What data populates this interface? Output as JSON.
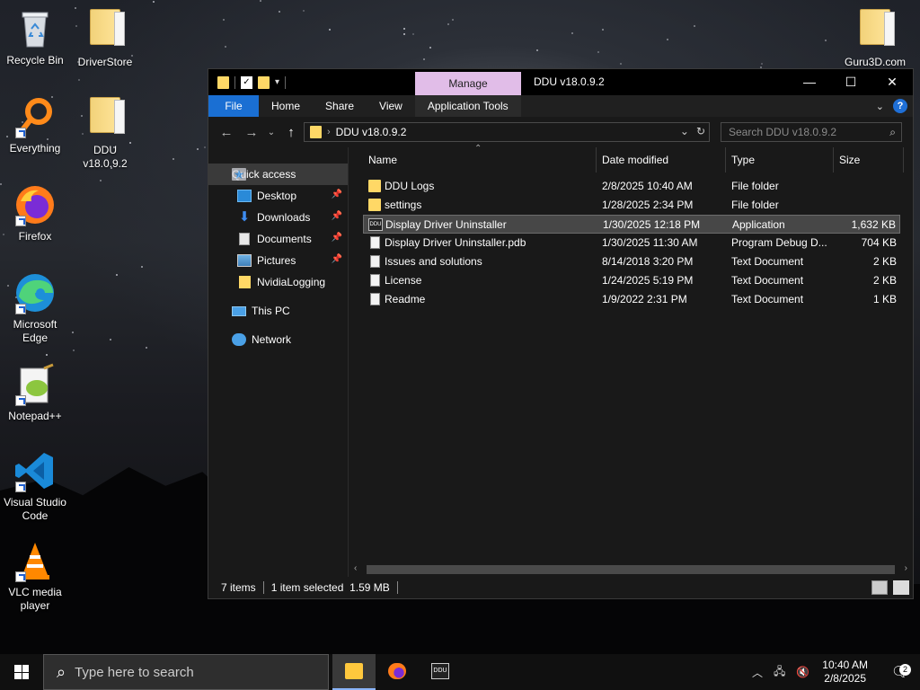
{
  "desktop": {
    "icons": [
      {
        "label": "Recycle Bin",
        "icon": "recycle-bin-icon"
      },
      {
        "label": "DriverStore",
        "icon": "folder-icon"
      },
      {
        "label": "Guru3D.com",
        "icon": "folder-icon"
      },
      {
        "label": "Everything",
        "icon": "everything-search-icon"
      },
      {
        "label": "DDU v18.0.9.2",
        "icon": "folder-zip-icon"
      },
      {
        "label": "Firefox",
        "icon": "firefox-icon"
      },
      {
        "label": "Microsoft Edge",
        "icon": "edge-icon"
      },
      {
        "label": "Notepad++",
        "icon": "notepadpp-icon"
      },
      {
        "label": "Visual Studio Code",
        "icon": "vscode-icon"
      },
      {
        "label": "VLC media player",
        "icon": "vlc-icon"
      }
    ]
  },
  "explorer": {
    "title": "DDU v18.0.9.2",
    "manage_tab": "Manage",
    "ribbon_tabs": [
      "File",
      "Home",
      "Share",
      "View",
      "Application Tools"
    ],
    "address": "DDU v18.0.9.2",
    "search_placeholder": "Search DDU v18.0.9.2",
    "nav": {
      "quick_access": "Quick access",
      "items": [
        {
          "label": "Desktop",
          "pinned": true
        },
        {
          "label": "Downloads",
          "pinned": true
        },
        {
          "label": "Documents",
          "pinned": true
        },
        {
          "label": "Pictures",
          "pinned": true
        },
        {
          "label": "NvidiaLogging",
          "pinned": false
        }
      ],
      "this_pc": "This PC",
      "network": "Network"
    },
    "columns": [
      "Name",
      "Date modified",
      "Type",
      "Size"
    ],
    "files": [
      {
        "name": "DDU Logs",
        "date": "2/8/2025 10:40 AM",
        "type": "File folder",
        "size": "",
        "kind": "folder"
      },
      {
        "name": "settings",
        "date": "1/28/2025 2:34 PM",
        "type": "File folder",
        "size": "",
        "kind": "folder"
      },
      {
        "name": "Display Driver Uninstaller",
        "date": "1/30/2025 12:18 PM",
        "type": "Application",
        "size": "1,632 KB",
        "kind": "app",
        "selected": true
      },
      {
        "name": "Display Driver Uninstaller.pdb",
        "date": "1/30/2025 11:30 AM",
        "type": "Program Debug D...",
        "size": "704 KB",
        "kind": "file"
      },
      {
        "name": "Issues and solutions",
        "date": "8/14/2018 3:20 PM",
        "type": "Text Document",
        "size": "2 KB",
        "kind": "file"
      },
      {
        "name": "License",
        "date": "1/24/2025 5:19 PM",
        "type": "Text Document",
        "size": "2 KB",
        "kind": "file"
      },
      {
        "name": "Readme",
        "date": "1/9/2022 2:31 PM",
        "type": "Text Document",
        "size": "1 KB",
        "kind": "file"
      }
    ],
    "status": {
      "items": "7 items",
      "selected": "1 item selected  1.59 MB"
    }
  },
  "taskbar": {
    "search_placeholder": "Type here to search",
    "time": "10:40 AM",
    "date": "2/8/2025",
    "notification_count": "2"
  }
}
